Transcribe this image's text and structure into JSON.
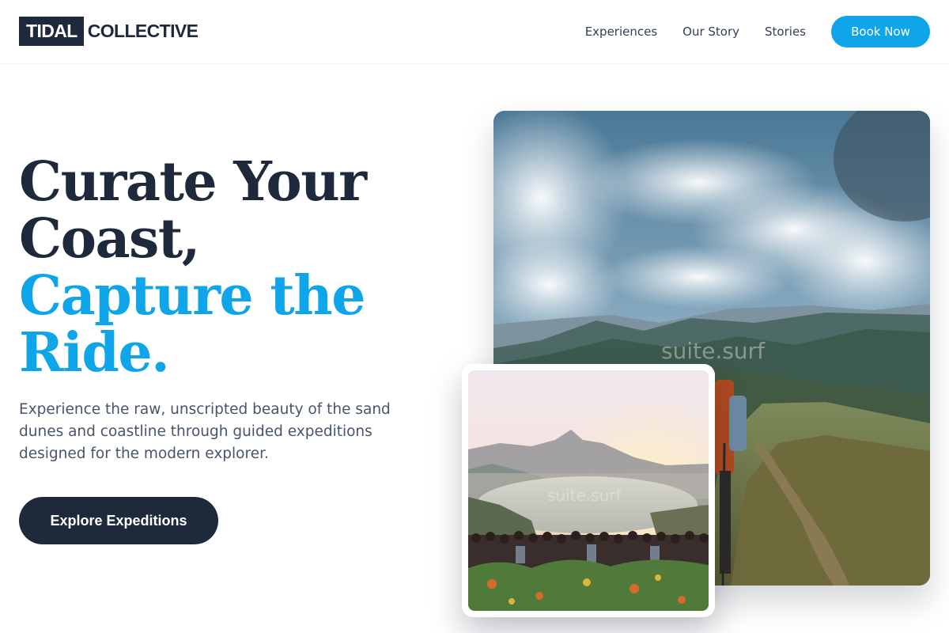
{
  "brand": {
    "box_text": "TIDAL",
    "text": "COLLECTIVE"
  },
  "nav": {
    "links": [
      "Experiences",
      "Our Story",
      "Stories"
    ],
    "cta_label": "Book Now"
  },
  "hero": {
    "title_line1": "Curate Your",
    "title_line2": "Coast,",
    "title_line3": "Capture the Ride.",
    "subtitle": "Experience the raw, unscripted beauty of the sand dunes and coastline through guided expeditions designed for the modern explorer.",
    "cta_label": "Explore Expeditions"
  },
  "images": {
    "main": {
      "icon": "mountain-hiker-photo",
      "watermark": "suite.surf"
    },
    "card": {
      "icon": "sunset-viewpoint-photo",
      "watermark": "suite.surf"
    }
  },
  "colors": {
    "dark": "#1e293b",
    "accent": "#0ea5e9",
    "muted_text": "#475569"
  }
}
